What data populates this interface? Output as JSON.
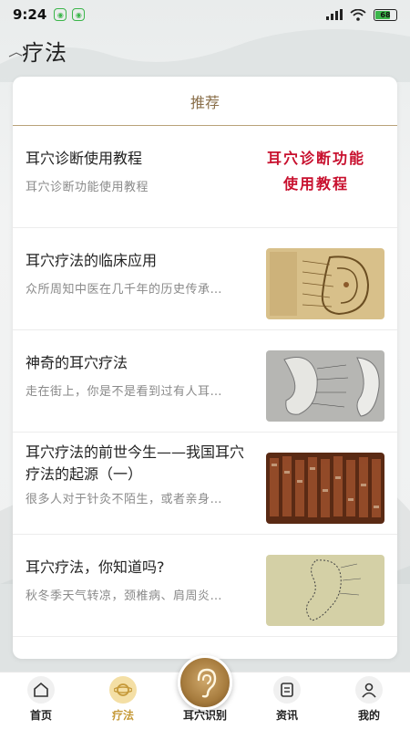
{
  "status": {
    "time": "9:24",
    "battery_level": 0.65,
    "battery_text": "68",
    "notification_icons": [
      "wechat-icon",
      "wechat-icon"
    ]
  },
  "header": {
    "title": "疗法"
  },
  "tabs": [
    {
      "label": "推荐",
      "active": true
    }
  ],
  "articles": [
    {
      "title": "耳穴诊断使用教程",
      "desc": "耳穴诊断功能使用教程",
      "thumb_caption": [
        "耳穴诊断功能",
        "使用教程"
      ]
    },
    {
      "title": "耳穴疗法的临床应用",
      "desc": "众所周知中医在几千年的历史传承…"
    },
    {
      "title": "神奇的耳穴疗法",
      "desc": "走在街上，你是不是看到过有人耳…"
    },
    {
      "title": "耳穴疗法的前世今生——我国耳穴疗法的起源（一）",
      "desc": "很多人对于针灸不陌生，或者亲身…"
    },
    {
      "title": "耳穴疗法，你知道吗?",
      "desc": "秋冬季天气转凉，颈椎病、肩周炎…"
    }
  ],
  "bottom_nav": [
    {
      "label": "首页",
      "icon": "home-icon",
      "active": false
    },
    {
      "label": "疗法",
      "icon": "planet-icon",
      "active": true
    },
    {
      "label": "耳穴识别",
      "icon": "ear-icon",
      "active": false
    },
    {
      "label": "资讯",
      "icon": "news-icon",
      "active": false
    },
    {
      "label": "我的",
      "icon": "user-icon",
      "active": false
    }
  ],
  "colors": {
    "accent": "#c69a3a",
    "tab_text": "#8a6f4a",
    "caption_red": "#c8102e"
  }
}
